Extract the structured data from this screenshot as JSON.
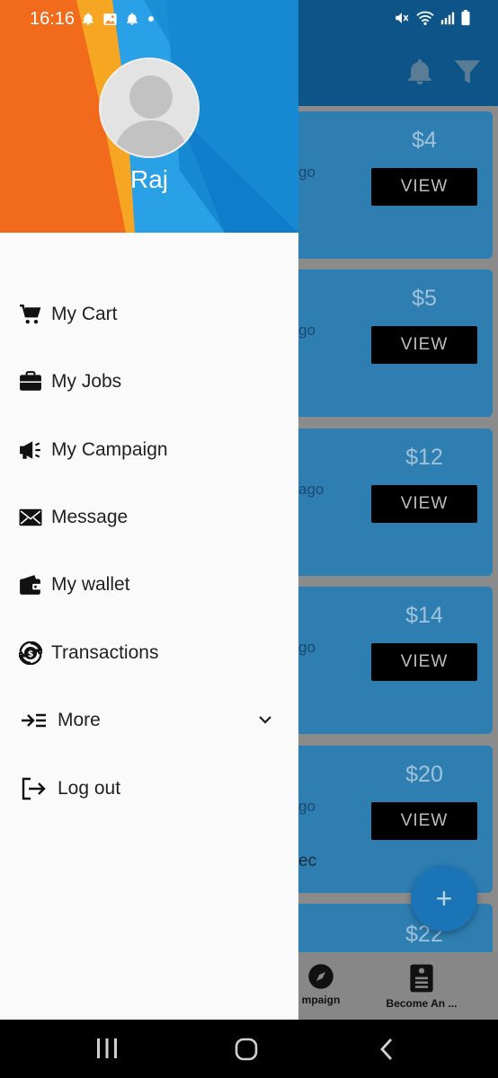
{
  "status_bar": {
    "time": "16:16",
    "icons_left": [
      "notification-bell-icon",
      "image-icon",
      "notification-bell-icon",
      "dot-icon"
    ],
    "icons_right": [
      "mute-icon",
      "wifi-icon",
      "signal-icon",
      "battery-icon"
    ]
  },
  "drawer": {
    "user_name": "Raj",
    "menu": [
      {
        "label": "My Cart",
        "icon": "cart-icon"
      },
      {
        "label": "My Jobs",
        "icon": "briefcase-icon"
      },
      {
        "label": "My Campaign",
        "icon": "megaphone-icon"
      },
      {
        "label": "Message",
        "icon": "envelope-icon"
      },
      {
        "label": "My wallet",
        "icon": "wallet-icon"
      },
      {
        "label": "Transactions",
        "icon": "transactions-icon"
      },
      {
        "label": "More",
        "icon": "expand-list-icon"
      },
      {
        "label": "Log out",
        "icon": "logout-icon"
      }
    ]
  },
  "background": {
    "cards": [
      {
        "price": "$4",
        "view_label": "VIEW",
        "ago": "go",
        "extra": ""
      },
      {
        "price": "$5",
        "view_label": "VIEW",
        "ago": "go",
        "extra": ""
      },
      {
        "price": "$12",
        "view_label": "VIEW",
        "ago": "ago",
        "extra": ""
      },
      {
        "price": "$14",
        "view_label": "VIEW",
        "ago": "go",
        "extra": ""
      },
      {
        "price": "$20",
        "view_label": "VIEW",
        "ago": "go",
        "extra": "ec"
      },
      {
        "price": "$22",
        "view_label": "",
        "ago": "",
        "extra": ""
      }
    ],
    "fab_label": "+",
    "bottom_nav": [
      {
        "label": "mpaign",
        "icon": "compass-icon"
      },
      {
        "label": "Become An ...",
        "icon": "resume-icon"
      }
    ]
  },
  "colors": {
    "drawer_bg": "#fafafa",
    "header_blue": "#1a8fd6",
    "header_orange": "#f26a1b",
    "header_yellow": "#f6a623",
    "card_bg": "#2e7eb2",
    "app_header": "#0d5588"
  }
}
